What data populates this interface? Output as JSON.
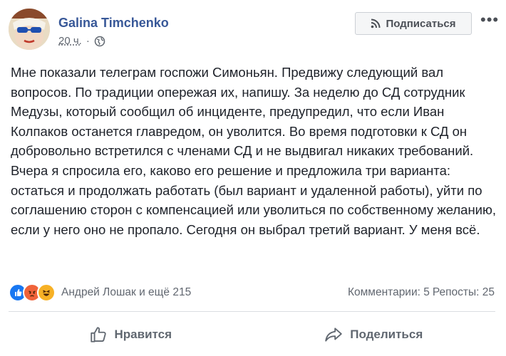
{
  "post": {
    "author": "Galina Timchenko",
    "time": "20 ч.",
    "separator": "·",
    "privacy_icon": "globe-icon",
    "subscribe_label": "Подписаться",
    "subscribe_icon": "rss-icon",
    "more_label": "•••",
    "text": "Мне показали телеграм госпожи Симоньян. Предвижу следующий вал вопросов. По традиции опережая их, напишу. За неделю до СД сотрудник Медузы, который сообщил об инциденте, предупредил, что если Иван Колпаков останется главредом, он уволится. Во время подготовки к СД он добровольно встретился с членами СД и не выдвигал никаких требований. Вчера я спросила его, каково его решение и предложила три варианта: остаться и продолжать работать (был вариант и удаленной работы), уйти по соглашению сторон с компенсацией или уволиться по собственному желанию, если у него оно не пропало. Сегодня он выбрал третий вариант. У меня всё."
  },
  "reactions": {
    "icons": [
      "like-reaction-icon",
      "angry-reaction-icon",
      "haha-reaction-icon"
    ],
    "names": "Андрей Лошак и ещё 215",
    "comments": "Комментарии: 5",
    "shares": "Репосты: 25"
  },
  "actions": {
    "like_label": "Нравится",
    "share_label": "Поделиться"
  },
  "colors": {
    "author": "#385898",
    "like_blue": "#1877f2",
    "angry": "#f0633a",
    "haha": "#f7b125"
  }
}
